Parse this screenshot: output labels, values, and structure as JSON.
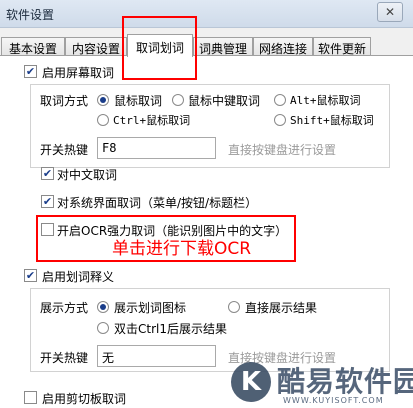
{
  "window": {
    "title": "软件设置",
    "close_glyph": "✕"
  },
  "tabs": [
    {
      "label": "基本设置",
      "active": false
    },
    {
      "label": "内容设置",
      "active": false
    },
    {
      "label": "取词划词",
      "active": true
    },
    {
      "label": "词典管理",
      "active": false
    },
    {
      "label": "网络连接",
      "active": false
    },
    {
      "label": "软件更新",
      "active": false
    }
  ],
  "screen_capture": {
    "enable_label": "启用屏幕取词",
    "enabled": true,
    "method_label": "取词方式",
    "options": [
      {
        "label": "鼠标取词",
        "selected": true
      },
      {
        "label": "鼠标中键取词",
        "selected": false
      },
      {
        "label": "Alt+鼠标取词",
        "selected": false
      },
      {
        "label": "Ctrl+鼠标取词",
        "selected": false
      },
      {
        "label": "Shift+鼠标取词",
        "selected": false
      }
    ],
    "hotkey_label": "开关热键",
    "hotkey_value": "F8",
    "hotkey_hint": "直接按键盘进行设置",
    "chinese_label": "对中文取词",
    "chinese_checked": true,
    "system_ui_label": "对系统界面取词（菜单/按钮/标题栏）",
    "system_ui_checked": true,
    "ocr_label": "开启OCR强力取词（能识别图片中的文字）",
    "ocr_checked": false
  },
  "selection": {
    "enable_label": "启用划词释义",
    "enabled": true,
    "method_label": "展示方式",
    "options": [
      {
        "label": "展示划词图标",
        "selected": true
      },
      {
        "label": "直接展示结果",
        "selected": false
      },
      {
        "label": "双击Ctrl1后展示结果",
        "selected": false
      }
    ],
    "hotkey_label": "开关热键",
    "hotkey_value": "无",
    "hotkey_hint": "直接按键盘进行设置"
  },
  "clipboard": {
    "enable_label": "启用剪切板取词",
    "enabled": false
  },
  "annotation": {
    "text": "单击进行下载OCR",
    "color": "#ff0000"
  },
  "watermark": {
    "logo": "K",
    "name": "酷易软件园",
    "url": "WWW.KUYISOFT.COM"
  },
  "check_glyph": "✔"
}
